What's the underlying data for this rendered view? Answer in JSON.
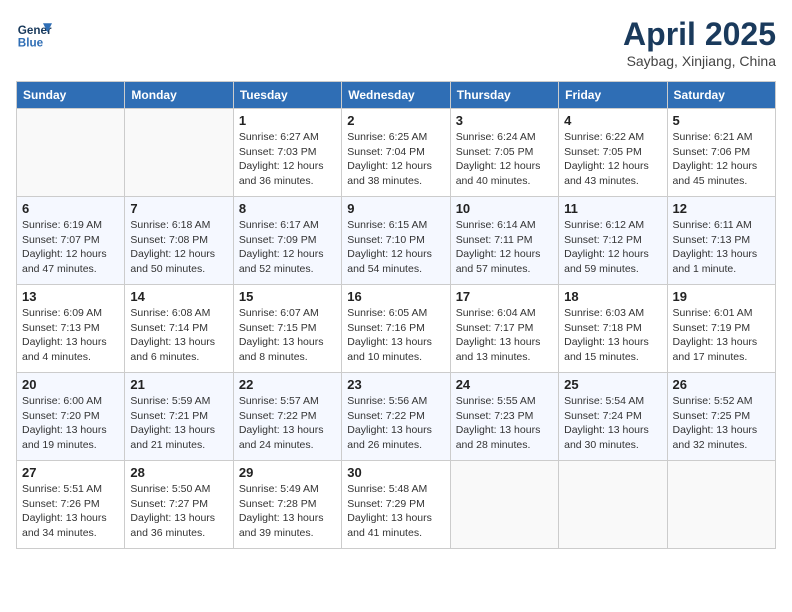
{
  "header": {
    "logo_line1": "General",
    "logo_line2": "Blue",
    "month": "April 2025",
    "location": "Saybag, Xinjiang, China"
  },
  "weekdays": [
    "Sunday",
    "Monday",
    "Tuesday",
    "Wednesday",
    "Thursday",
    "Friday",
    "Saturday"
  ],
  "weeks": [
    [
      {
        "day": "",
        "info": ""
      },
      {
        "day": "",
        "info": ""
      },
      {
        "day": "1",
        "info": "Sunrise: 6:27 AM\nSunset: 7:03 PM\nDaylight: 12 hours\nand 36 minutes."
      },
      {
        "day": "2",
        "info": "Sunrise: 6:25 AM\nSunset: 7:04 PM\nDaylight: 12 hours\nand 38 minutes."
      },
      {
        "day": "3",
        "info": "Sunrise: 6:24 AM\nSunset: 7:05 PM\nDaylight: 12 hours\nand 40 minutes."
      },
      {
        "day": "4",
        "info": "Sunrise: 6:22 AM\nSunset: 7:05 PM\nDaylight: 12 hours\nand 43 minutes."
      },
      {
        "day": "5",
        "info": "Sunrise: 6:21 AM\nSunset: 7:06 PM\nDaylight: 12 hours\nand 45 minutes."
      }
    ],
    [
      {
        "day": "6",
        "info": "Sunrise: 6:19 AM\nSunset: 7:07 PM\nDaylight: 12 hours\nand 47 minutes."
      },
      {
        "day": "7",
        "info": "Sunrise: 6:18 AM\nSunset: 7:08 PM\nDaylight: 12 hours\nand 50 minutes."
      },
      {
        "day": "8",
        "info": "Sunrise: 6:17 AM\nSunset: 7:09 PM\nDaylight: 12 hours\nand 52 minutes."
      },
      {
        "day": "9",
        "info": "Sunrise: 6:15 AM\nSunset: 7:10 PM\nDaylight: 12 hours\nand 54 minutes."
      },
      {
        "day": "10",
        "info": "Sunrise: 6:14 AM\nSunset: 7:11 PM\nDaylight: 12 hours\nand 57 minutes."
      },
      {
        "day": "11",
        "info": "Sunrise: 6:12 AM\nSunset: 7:12 PM\nDaylight: 12 hours\nand 59 minutes."
      },
      {
        "day": "12",
        "info": "Sunrise: 6:11 AM\nSunset: 7:13 PM\nDaylight: 13 hours\nand 1 minute."
      }
    ],
    [
      {
        "day": "13",
        "info": "Sunrise: 6:09 AM\nSunset: 7:13 PM\nDaylight: 13 hours\nand 4 minutes."
      },
      {
        "day": "14",
        "info": "Sunrise: 6:08 AM\nSunset: 7:14 PM\nDaylight: 13 hours\nand 6 minutes."
      },
      {
        "day": "15",
        "info": "Sunrise: 6:07 AM\nSunset: 7:15 PM\nDaylight: 13 hours\nand 8 minutes."
      },
      {
        "day": "16",
        "info": "Sunrise: 6:05 AM\nSunset: 7:16 PM\nDaylight: 13 hours\nand 10 minutes."
      },
      {
        "day": "17",
        "info": "Sunrise: 6:04 AM\nSunset: 7:17 PM\nDaylight: 13 hours\nand 13 minutes."
      },
      {
        "day": "18",
        "info": "Sunrise: 6:03 AM\nSunset: 7:18 PM\nDaylight: 13 hours\nand 15 minutes."
      },
      {
        "day": "19",
        "info": "Sunrise: 6:01 AM\nSunset: 7:19 PM\nDaylight: 13 hours\nand 17 minutes."
      }
    ],
    [
      {
        "day": "20",
        "info": "Sunrise: 6:00 AM\nSunset: 7:20 PM\nDaylight: 13 hours\nand 19 minutes."
      },
      {
        "day": "21",
        "info": "Sunrise: 5:59 AM\nSunset: 7:21 PM\nDaylight: 13 hours\nand 21 minutes."
      },
      {
        "day": "22",
        "info": "Sunrise: 5:57 AM\nSunset: 7:22 PM\nDaylight: 13 hours\nand 24 minutes."
      },
      {
        "day": "23",
        "info": "Sunrise: 5:56 AM\nSunset: 7:22 PM\nDaylight: 13 hours\nand 26 minutes."
      },
      {
        "day": "24",
        "info": "Sunrise: 5:55 AM\nSunset: 7:23 PM\nDaylight: 13 hours\nand 28 minutes."
      },
      {
        "day": "25",
        "info": "Sunrise: 5:54 AM\nSunset: 7:24 PM\nDaylight: 13 hours\nand 30 minutes."
      },
      {
        "day": "26",
        "info": "Sunrise: 5:52 AM\nSunset: 7:25 PM\nDaylight: 13 hours\nand 32 minutes."
      }
    ],
    [
      {
        "day": "27",
        "info": "Sunrise: 5:51 AM\nSunset: 7:26 PM\nDaylight: 13 hours\nand 34 minutes."
      },
      {
        "day": "28",
        "info": "Sunrise: 5:50 AM\nSunset: 7:27 PM\nDaylight: 13 hours\nand 36 minutes."
      },
      {
        "day": "29",
        "info": "Sunrise: 5:49 AM\nSunset: 7:28 PM\nDaylight: 13 hours\nand 39 minutes."
      },
      {
        "day": "30",
        "info": "Sunrise: 5:48 AM\nSunset: 7:29 PM\nDaylight: 13 hours\nand 41 minutes."
      },
      {
        "day": "",
        "info": ""
      },
      {
        "day": "",
        "info": ""
      },
      {
        "day": "",
        "info": ""
      }
    ]
  ]
}
